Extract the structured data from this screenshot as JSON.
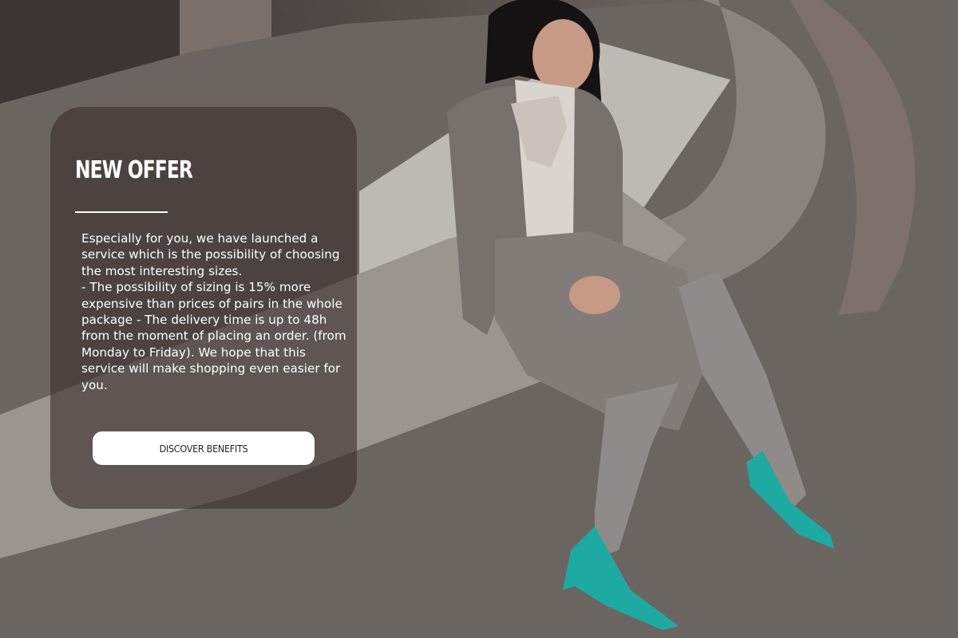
{
  "offer": {
    "title": "NEW OFFER",
    "body": "Especially for you, we have launched a service which is the possibility of choosing the most interesting sizes.\n- The possibility of sizing is 15% more expensive than prices of pairs in the whole package - The delivery time is up to 48h from the moment of placing an order. (from Monday to Friday). We hope that this service will make shopping even easier for you.",
    "cta_label": "DISCOVER BENEFITS"
  },
  "colors": {
    "card_overlay": "#3a2f2d",
    "text": "#ffffff",
    "button_bg": "#ffffff",
    "shoe_accent": "#1fa9a3"
  }
}
